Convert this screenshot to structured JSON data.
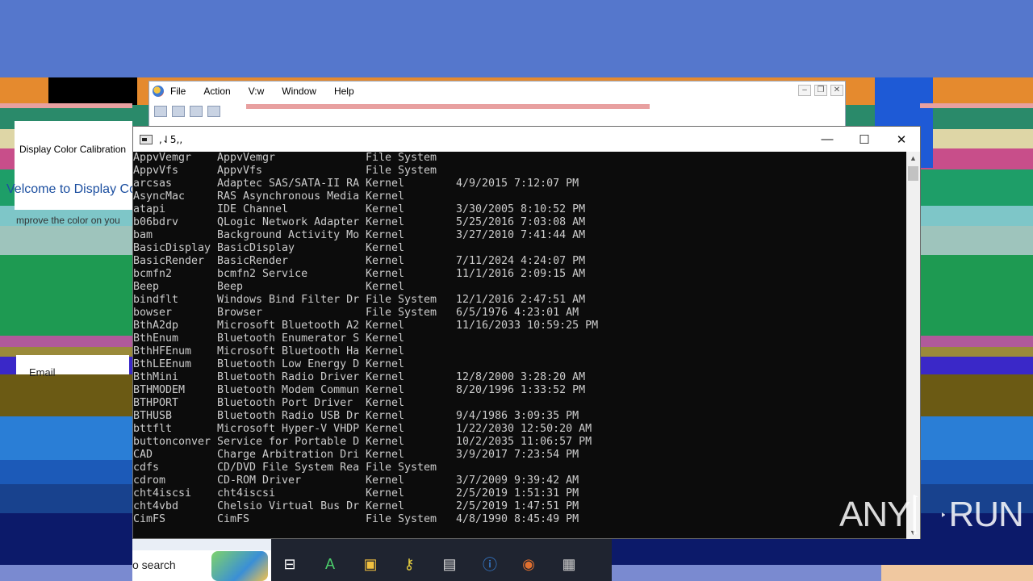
{
  "mmc": {
    "menu": [
      "File",
      "Action",
      "V:w",
      "Window",
      "Help"
    ]
  },
  "display_calibration": {
    "title": "Display Color Calibration",
    "heading": "Velcome to Display Co",
    "subtext": "mprove the color on you"
  },
  "email_label": "Email",
  "console": {
    "title": ",⇃5,,",
    "rows": [
      [
        "AppvVemgr",
        "AppvVemgr",
        "File System",
        ""
      ],
      [
        "AppvVfs",
        "AppvVfs",
        "File System",
        ""
      ],
      [
        "arcsas",
        "Adaptec SAS/SATA-II RA",
        "Kernel",
        "4/9/2015 7:12:07 PM"
      ],
      [
        "AsyncMac",
        "RAS Asynchronous Media",
        "Kernel",
        ""
      ],
      [
        "atapi",
        "IDE Channel",
        "Kernel",
        "3/30/2005 8:10:52 PM"
      ],
      [
        "b06bdrv",
        "QLogic Network Adapter",
        "Kernel",
        "5/25/2016 7:03:08 AM"
      ],
      [
        "bam",
        "Background Activity Mo",
        "Kernel",
        "3/27/2010 7:41:44 AM"
      ],
      [
        "BasicDisplay",
        "BasicDisplay",
        "Kernel",
        ""
      ],
      [
        "BasicRender",
        "BasicRender",
        "Kernel",
        "7/11/2024 4:24:07 PM"
      ],
      [
        "bcmfn2",
        "bcmfn2 Service",
        "Kernel",
        "11/1/2016 2:09:15 AM"
      ],
      [
        "Beep",
        "Beep",
        "Kernel",
        ""
      ],
      [
        "bindflt",
        "Windows Bind Filter Dr",
        "File System",
        "12/1/2016 2:47:51 AM"
      ],
      [
        "bowser",
        "Browser",
        "File System",
        "6/5/1976 4:23:01 AM"
      ],
      [
        "BthA2dp",
        "Microsoft Bluetooth A2",
        "Kernel",
        "11/16/2033 10:59:25 PM"
      ],
      [
        "BthEnum",
        "Bluetooth Enumerator S",
        "Kernel",
        ""
      ],
      [
        "BthHFEnum",
        "Microsoft Bluetooth Ha",
        "Kernel",
        ""
      ],
      [
        "BthLEEnum",
        "Bluetooth Low Energy D",
        "Kernel",
        ""
      ],
      [
        "BthMini",
        "Bluetooth Radio Driver",
        "Kernel",
        "12/8/2000 3:28:20 AM"
      ],
      [
        "BTHMODEM",
        "Bluetooth Modem Commun",
        "Kernel",
        "8/20/1996 1:33:52 PM"
      ],
      [
        "BTHPORT",
        "Bluetooth Port Driver",
        "Kernel",
        ""
      ],
      [
        "BTHUSB",
        "Bluetooth Radio USB Dr",
        "Kernel",
        "9/4/1986 3:09:35 PM"
      ],
      [
        "bttflt",
        "Microsoft Hyper-V VHDP",
        "Kernel",
        "1/22/2030 12:50:20 AM"
      ],
      [
        "buttonconver",
        "Service for Portable D",
        "Kernel",
        "10/2/2035 11:06:57 PM"
      ],
      [
        "CAD",
        "Charge Arbitration Dri",
        "Kernel",
        "3/9/2017 7:23:54 PM"
      ],
      [
        "cdfs",
        "CD/DVD File System Rea",
        "File System",
        ""
      ],
      [
        "cdrom",
        "CD-ROM Driver",
        "Kernel",
        "3/7/2009 9:39:42 AM"
      ],
      [
        "cht4iscsi",
        "cht4iscsi",
        "Kernel",
        "2/5/2019 1:51:31 PM"
      ],
      [
        "cht4vbd",
        "Chelsio Virtual Bus Dr",
        "Kernel",
        "2/5/2019 1:47:51 PM"
      ],
      [
        "CimFS",
        "CimFS",
        "File System",
        "4/8/1990 8:45:49 PM"
      ]
    ]
  },
  "taskbar": {
    "search_text": "o search"
  },
  "watermark": {
    "left": "ANY",
    "right": "RUN"
  },
  "colors": {
    "desktop": "#5577cc",
    "console_bg": "#0c0c0c",
    "console_text": "#cccccc"
  }
}
